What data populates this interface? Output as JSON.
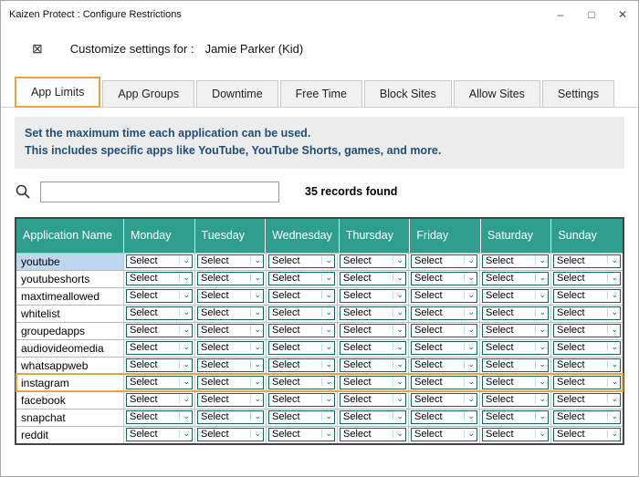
{
  "window": {
    "title": "Kaizen Protect : Configure Restrictions",
    "minimize": "–",
    "maximize": "□",
    "close": "✕"
  },
  "header": {
    "icon": "⊠",
    "label": "Customize settings for :",
    "value": "Jamie Parker (Kid)"
  },
  "tabs": [
    {
      "label": "App Limits",
      "active": true
    },
    {
      "label": "App Groups",
      "active": false
    },
    {
      "label": "Downtime",
      "active": false
    },
    {
      "label": "Free Time",
      "active": false
    },
    {
      "label": "Block Sites",
      "active": false
    },
    {
      "label": "Allow Sites",
      "active": false
    },
    {
      "label": "Settings",
      "active": false
    }
  ],
  "info": {
    "line1": "Set the maximum time each application can be used.",
    "line2": "This includes specific apps like YouTube, YouTube Shorts, games, and more."
  },
  "search": {
    "value": "",
    "placeholder": "",
    "records_text": "35 records found"
  },
  "table": {
    "columns": [
      "Application Name",
      "Monday",
      "Tuesday",
      "Wednesday",
      "Thursday",
      "Friday",
      "Saturday",
      "Sunday"
    ],
    "select_label": "Select",
    "rows": [
      {
        "app": "youtube",
        "highlight": "selected"
      },
      {
        "app": "youtubeshorts",
        "highlight": "none"
      },
      {
        "app": "maxtimeallowed",
        "highlight": "none"
      },
      {
        "app": "whitelist",
        "highlight": "none"
      },
      {
        "app": "groupedapps",
        "highlight": "none"
      },
      {
        "app": "audiovideomedia",
        "highlight": "none"
      },
      {
        "app": "whatsappweb",
        "highlight": "none"
      },
      {
        "app": "instagram",
        "highlight": "outlined"
      },
      {
        "app": "facebook",
        "highlight": "none"
      },
      {
        "app": "snapchat",
        "highlight": "none"
      },
      {
        "app": "reddit",
        "highlight": "none"
      }
    ]
  },
  "colors": {
    "teal_header": "#2E9E8E",
    "accent_orange": "#E8A33D",
    "info_text": "#1F4E79",
    "row_selected": "#BDD7EE",
    "select_border": "#17625C"
  }
}
